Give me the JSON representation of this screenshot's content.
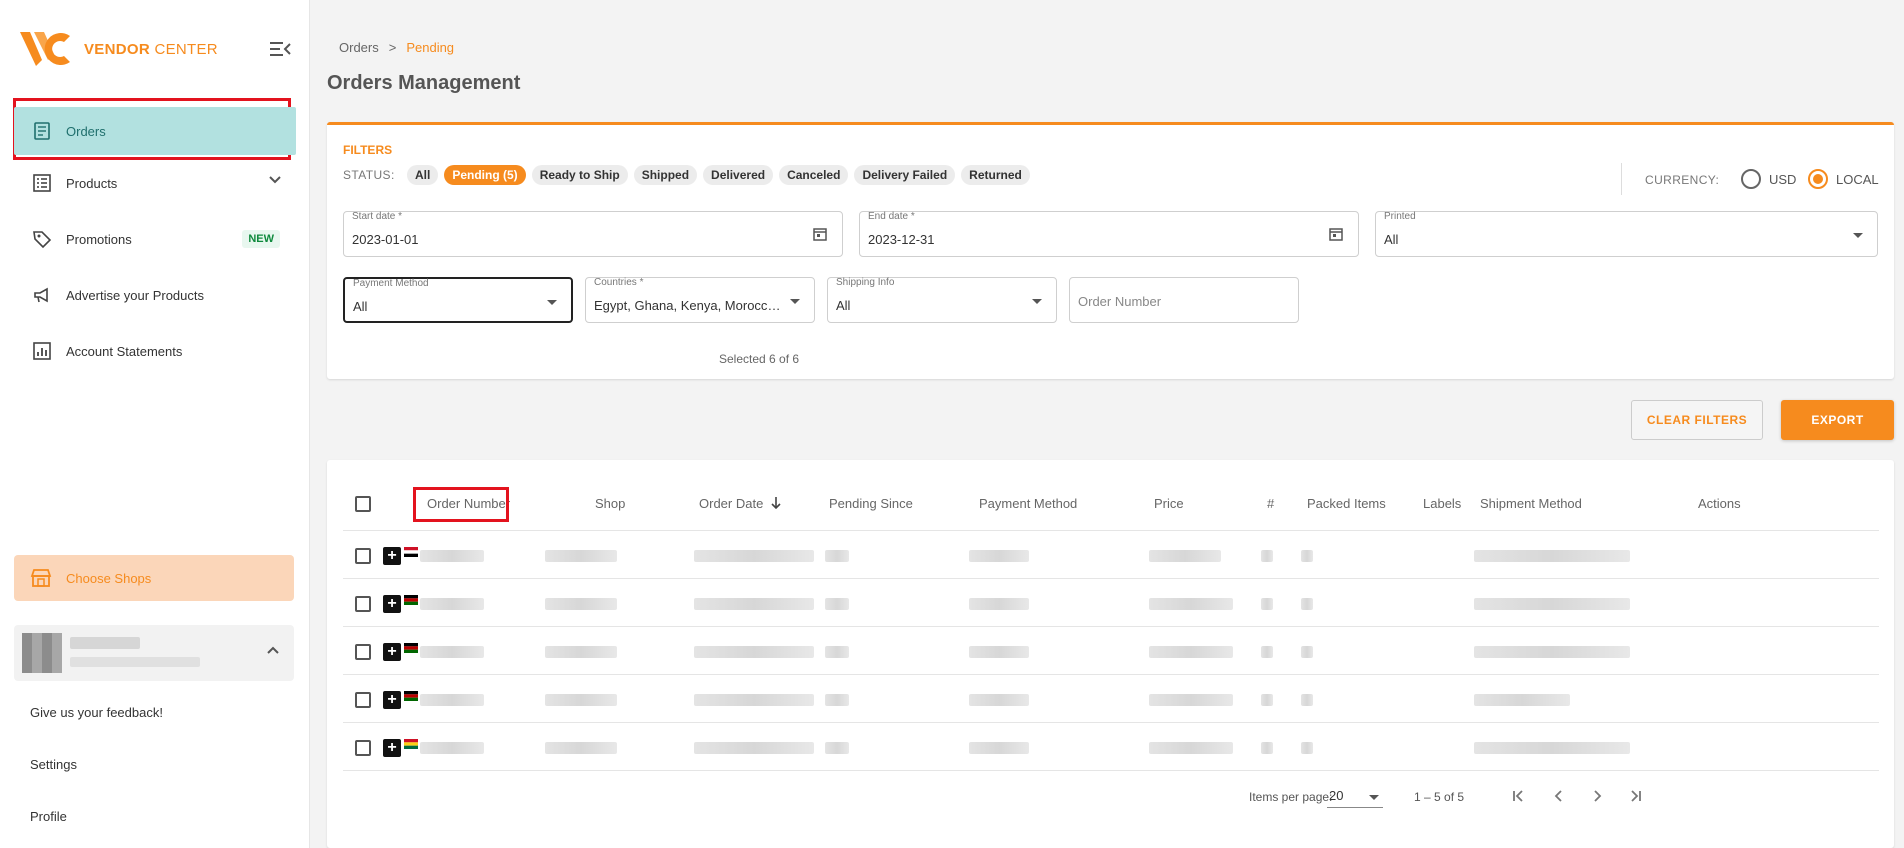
{
  "brand": {
    "name_bold": "VENDOR",
    "name_light": "CENTER",
    "color": "#f68b1e"
  },
  "sidebar": {
    "items": [
      {
        "label": "Orders",
        "icon": "receipt-icon"
      },
      {
        "label": "Products",
        "icon": "list-icon"
      },
      {
        "label": "Promotions",
        "icon": "tag-icon",
        "badge": "NEW"
      },
      {
        "label": "Advertise your Products",
        "icon": "megaphone-icon"
      },
      {
        "label": "Account Statements",
        "icon": "chart-icon"
      }
    ],
    "choose_shops": "Choose Shops",
    "links": {
      "feedback": "Give us your feedback!",
      "settings": "Settings",
      "profile": "Profile"
    }
  },
  "breadcrumb": {
    "parent": "Orders",
    "separator": ">",
    "current": "Pending"
  },
  "page_title": "Orders Management",
  "filters": {
    "title": "FILTERS",
    "status_label": "STATUS:",
    "statuses": [
      "All",
      "Pending (5)",
      "Ready to Ship",
      "Shipped",
      "Delivered",
      "Canceled",
      "Delivery Failed",
      "Returned"
    ],
    "active_status": "Pending (5)",
    "currency_label": "CURRENCY:",
    "currency_options": [
      "USD",
      "LOCAL"
    ],
    "currency_selected": "LOCAL",
    "start_date": {
      "label": "Start date *",
      "value": "2023-01-01"
    },
    "end_date": {
      "label": "End date *",
      "value": "2023-12-31"
    },
    "printed": {
      "label": "Printed",
      "value": "All"
    },
    "payment_method": {
      "label": "Payment Method",
      "value": "All"
    },
    "countries": {
      "label": "Countries *",
      "value": "Egypt, Ghana, Kenya, Morocco, ...",
      "helper": "Selected 6 of 6"
    },
    "shipping_info": {
      "label": "Shipping Info",
      "value": "All"
    },
    "order_number": {
      "placeholder": "Order Number"
    }
  },
  "actions": {
    "clear": "CLEAR FILTERS",
    "export": "EXPORT"
  },
  "table": {
    "columns": [
      "Order Number",
      "Shop",
      "Order Date",
      "Pending Since",
      "Payment Method",
      "Price",
      "#",
      "Packed Items",
      "Labels",
      "Shipment Method",
      "Actions"
    ],
    "sort_icon": "arrow-down-icon",
    "row_flags": [
      "egypt",
      "kenya",
      "kenya",
      "kenya",
      "ghana"
    ]
  },
  "pagination": {
    "items_per_page_label": "Items per page:",
    "items_per_page": "20",
    "range": "1 – 5 of 5"
  }
}
